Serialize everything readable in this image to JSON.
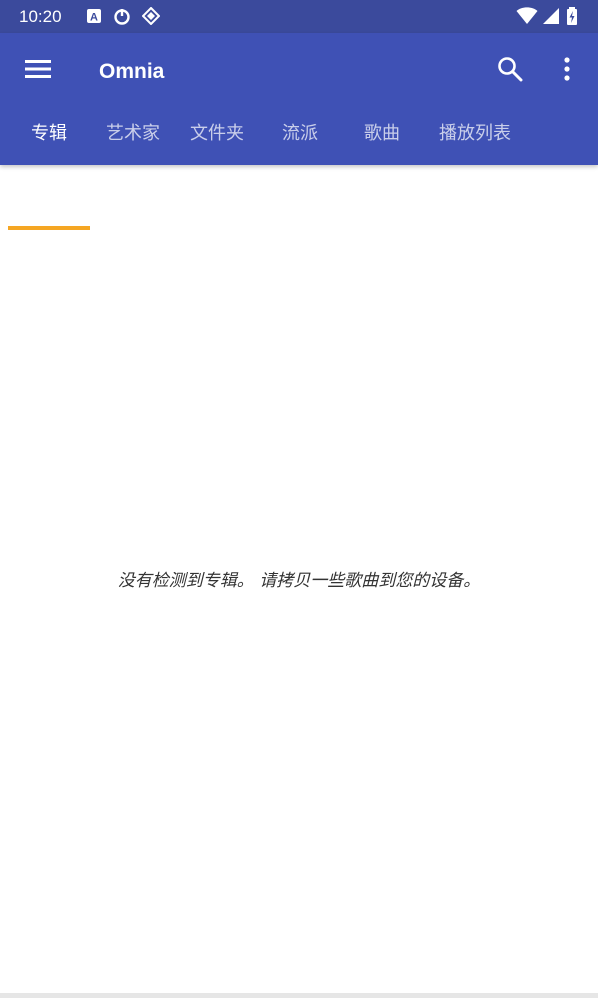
{
  "status_bar": {
    "time": "10:20",
    "left_icons": [
      "a-badge-icon",
      "power-icon",
      "diamond-icon"
    ],
    "right_icons": [
      "wifi-icon",
      "signal-icon",
      "battery-charging-icon"
    ]
  },
  "app_bar": {
    "title": "Omnia",
    "color": "#3f51b5",
    "status_color": "#3b4a9c",
    "actions": [
      "menu-icon",
      "search-icon",
      "more-vert-icon"
    ]
  },
  "tabs": [
    {
      "label": "专辑",
      "active": true
    },
    {
      "label": "艺术家",
      "active": false
    },
    {
      "label": "文件夹",
      "active": false
    },
    {
      "label": "流派",
      "active": false
    },
    {
      "label": "歌曲",
      "active": false
    },
    {
      "label": "播放列表",
      "active": false
    }
  ],
  "tab_indicator_color": "#f5a623",
  "content": {
    "empty_message": "没有检测到专辑。 请拷贝一些歌曲到您的设备。"
  }
}
